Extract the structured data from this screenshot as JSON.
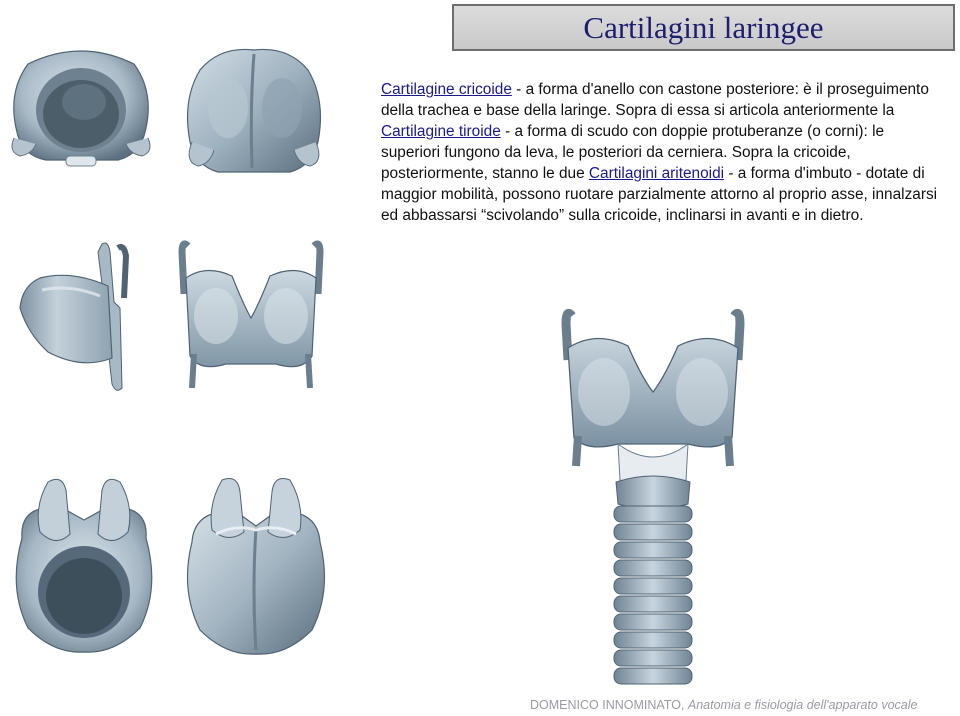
{
  "slide": {
    "title": "Cartilagini laringee",
    "paragraph": {
      "link1": "Cartilagine cricoide",
      "text1": " - a forma d'anello con castone posteriore: è il proseguimento della trachea e base della laringe. Sopra di essa si articola anteriormente la ",
      "link2": "Cartilagine tiroide",
      "text2": " - a forma di scudo con doppie protuberanze (o corni): le superiori fungono da leva, le posteriori da cerniera. Sopra la cricoide, posteriormente, stanno le due ",
      "link3": "Cartilagini aritenoidi",
      "text3": " - a forma d'imbuto - dotate di maggior mobilità, possono ruotare parzialmente attorno al proprio asse, innalzarsi ed abbassarsi “scivolando” sulla cricoide, inclinarsi in avanti e in dietro."
    },
    "footer": {
      "author": "DOMENICO INNOMINATO, ",
      "course": "Anatomia e fisiologia dell'apparato vocale"
    }
  },
  "colors": {
    "title_text": "#1d1f6e",
    "link": "#1a1a8c",
    "cartilage_light": "#c9d6df",
    "cartilage_mid": "#9fb2c0",
    "cartilage_dark": "#5c7182",
    "footer_text": "#9a9aa6"
  }
}
